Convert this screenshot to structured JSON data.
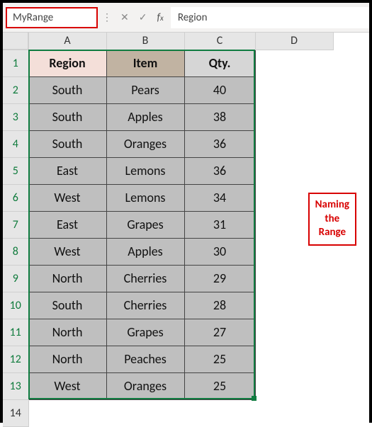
{
  "nameBox": "MyRange",
  "formulaBar": "Region",
  "columns": [
    "A",
    "B",
    "C",
    "D"
  ],
  "rowNumbers": [
    1,
    2,
    3,
    4,
    5,
    6,
    7,
    8,
    9,
    10,
    11,
    12,
    13,
    14
  ],
  "headers": {
    "region": "Region",
    "item": "Item",
    "qty": "Qty."
  },
  "table": [
    {
      "region": "South",
      "item": "Pears",
      "qty": "40"
    },
    {
      "region": "South",
      "item": "Apples",
      "qty": "38"
    },
    {
      "region": "South",
      "item": "Oranges",
      "qty": "36"
    },
    {
      "region": "East",
      "item": "Lemons",
      "qty": "36"
    },
    {
      "region": "West",
      "item": "Lemons",
      "qty": "34"
    },
    {
      "region": "East",
      "item": "Grapes",
      "qty": "31"
    },
    {
      "region": "West",
      "item": "Apples",
      "qty": "30"
    },
    {
      "region": "North",
      "item": "Cherries",
      "qty": "29"
    },
    {
      "region": "South",
      "item": "Cherries",
      "qty": "28"
    },
    {
      "region": "North",
      "item": "Grapes",
      "qty": "27"
    },
    {
      "region": "North",
      "item": "Peaches",
      "qty": "25"
    },
    {
      "region": "West",
      "item": "Oranges",
      "qty": "25"
    }
  ],
  "annotation": {
    "l1": "Naming",
    "l2": "the",
    "l3": "Range"
  },
  "selectedRowsGreen": true,
  "chart_data": {
    "type": "table",
    "title": "MyRange",
    "columns": [
      "Region",
      "Item",
      "Qty."
    ],
    "rows": [
      [
        "South",
        "Pears",
        40
      ],
      [
        "South",
        "Apples",
        38
      ],
      [
        "South",
        "Oranges",
        36
      ],
      [
        "East",
        "Lemons",
        36
      ],
      [
        "West",
        "Lemons",
        34
      ],
      [
        "East",
        "Grapes",
        31
      ],
      [
        "West",
        "Apples",
        30
      ],
      [
        "North",
        "Cherries",
        29
      ],
      [
        "South",
        "Cherries",
        28
      ],
      [
        "North",
        "Grapes",
        27
      ],
      [
        "North",
        "Peaches",
        25
      ],
      [
        "West",
        "Oranges",
        25
      ]
    ]
  }
}
